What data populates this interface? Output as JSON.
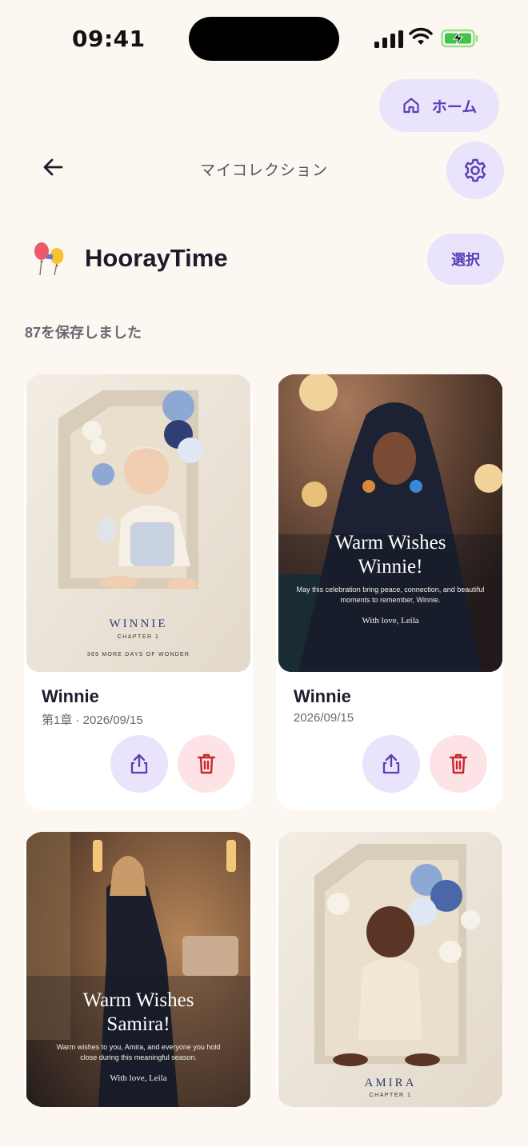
{
  "status_bar": {
    "time": "09:41"
  },
  "header": {
    "home_label": "ホーム",
    "title": "マイコレクション"
  },
  "brand": {
    "name": "HoorayTime"
  },
  "actions": {
    "select_label": "選択"
  },
  "collection": {
    "saved_count_text": "87を保存しました",
    "cards": [
      {
        "title": "Winnie",
        "subtitle": "第1章 · 2026/09/15",
        "image_text": {
          "name": "WINNIE",
          "chapter": "CHAPTER 1",
          "tagline": "365 MORE DAYS OF WONDER"
        }
      },
      {
        "title": "Winnie",
        "subtitle": "2026/09/15",
        "image_text": {
          "heading": "Warm Wishes Winnie!",
          "body": "May this celebration bring peace, connection, and beautiful moments to remember, Winnie.",
          "signature": "With love, Leila"
        }
      },
      {
        "image_text": {
          "heading": "Warm Wishes Samira!",
          "body": "Warm wishes to you, Amira, and everyone you hold close during this meaningful season.",
          "signature": "With love, Leila"
        }
      },
      {
        "image_text": {
          "name": "AMIRA",
          "chapter": "CHAPTER 1"
        }
      }
    ]
  },
  "colors": {
    "background": "#fdf7f1",
    "accent": "#5a3fb6",
    "accent_soft": "#e9e3fb",
    "danger": "#c8262f",
    "danger_soft": "#fde3e6"
  },
  "icons": [
    "home-icon",
    "back-arrow-icon",
    "gear-icon",
    "balloons-icon",
    "share-icon",
    "trash-icon",
    "signal-icon",
    "wifi-icon",
    "battery-icon"
  ]
}
